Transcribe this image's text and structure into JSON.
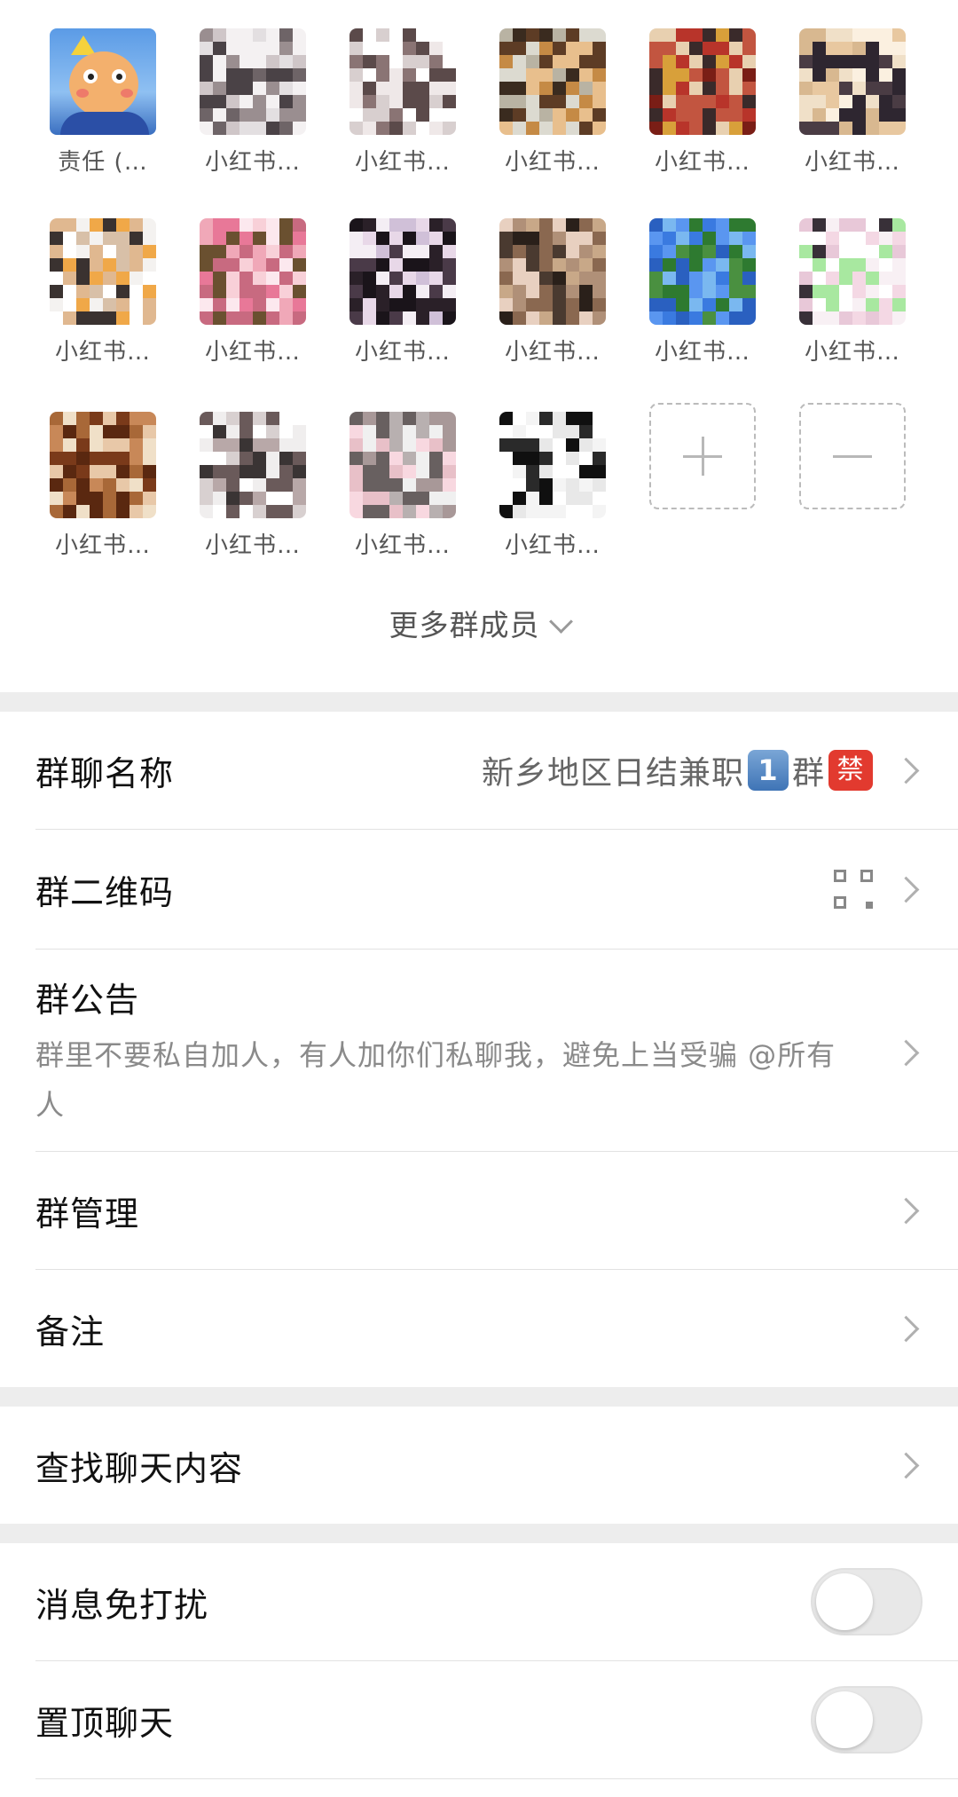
{
  "members": [
    {
      "name": "责任 (…",
      "type": "cartoon"
    },
    {
      "name": "小红书…",
      "palette": [
        "#4a4246",
        "#cfc6c8",
        "#e3dfe1",
        "#9a8e90",
        "#f4f1f2",
        "#6e6467"
      ]
    },
    {
      "name": "小红书…",
      "palette": [
        "#ffffff",
        "#5b4a4a",
        "#efe8e8",
        "#8a7474",
        "#ffffff",
        "#d8cfcf"
      ]
    },
    {
      "name": "小红书…",
      "palette": [
        "#b9b3a3",
        "#5d3c25",
        "#e8bf8d",
        "#c58a45",
        "#dcdad0",
        "#3a2b1f"
      ]
    },
    {
      "name": "小红书…",
      "palette": [
        "#7a1e16",
        "#d8a03a",
        "#b8342a",
        "#3a2a2a",
        "#e8d0b0",
        "#c25540"
      ]
    },
    {
      "name": "小红书…",
      "palette": [
        "#f0e0c8",
        "#4a3c44",
        "#e8c8a0",
        "#d8b890",
        "#2e2630",
        "#fbf0e0"
      ]
    },
    {
      "name": "小红书…",
      "palette": [
        "#f4f2f0",
        "#3a3230",
        "#e0b890",
        "#f0a848",
        "#d8c0a8",
        "#ffffff"
      ]
    },
    {
      "name": "小红书…",
      "palette": [
        "#f0a8b8",
        "#e87898",
        "#6a5030",
        "#f8d0d8",
        "#c86a80",
        "#fce8ee"
      ]
    },
    {
      "name": "小红书…",
      "palette": [
        "#2a2028",
        "#e8d8e8",
        "#4a3a48",
        "#d0c0d8",
        "#f4eef4",
        "#1a141a"
      ]
    },
    {
      "name": "小红书…",
      "palette": [
        "#4a3a30",
        "#c8a888",
        "#8a6850",
        "#e8d0c0",
        "#2a201a",
        "#b09078"
      ]
    },
    {
      "name": "小红书…",
      "palette": [
        "#3a7ae0",
        "#5a96f0",
        "#2a60c0",
        "#4a9040",
        "#7ab8f0",
        "#2e7a30"
      ]
    },
    {
      "name": "小红书…",
      "palette": [
        "#f8f0f4",
        "#e8c8d8",
        "#383038",
        "#f4d8e4",
        "#ffffff",
        "#a8e8a0"
      ]
    },
    {
      "name": "小红书…",
      "palette": [
        "#7a3a1a",
        "#f0e0c8",
        "#c88858",
        "#5a2810",
        "#e8c8a8",
        "#a86838"
      ]
    },
    {
      "name": "小红书…",
      "palette": [
        "#f0eeee",
        "#3a3434",
        "#b8a8a8",
        "#d8d0d0",
        "#6a5a5a",
        "#ffffff"
      ]
    },
    {
      "name": "小红书…",
      "palette": [
        "#f8d8e0",
        "#b8b0b0",
        "#e8c0c8",
        "#686060",
        "#f0f0f0",
        "#a89898"
      ]
    },
    {
      "name": "小红书…",
      "palette": [
        "#ffffff",
        "#101010",
        "#f4f4f4",
        "#2a2a2a",
        "#ffffff",
        "#e8e8e8"
      ]
    }
  ],
  "more_members_label": "更多群成员",
  "settings": {
    "group_name": {
      "label": "群聊名称",
      "prefix": "新乡地区日结兼职",
      "num_badge": "1",
      "mid": "群",
      "red_badge": "禁"
    },
    "qr_code": {
      "label": "群二维码"
    },
    "notice": {
      "label": "群公告",
      "content": "群里不要私自加人，有人加你们私聊我，避免上当受骗 @所有人"
    },
    "manage": {
      "label": "群管理"
    },
    "remark": {
      "label": "备注"
    }
  },
  "search": {
    "label": "查找聊天内容"
  },
  "toggles": {
    "mute": {
      "label": "消息免打扰",
      "on": false
    },
    "pin": {
      "label": "置顶聊天",
      "on": false
    }
  }
}
